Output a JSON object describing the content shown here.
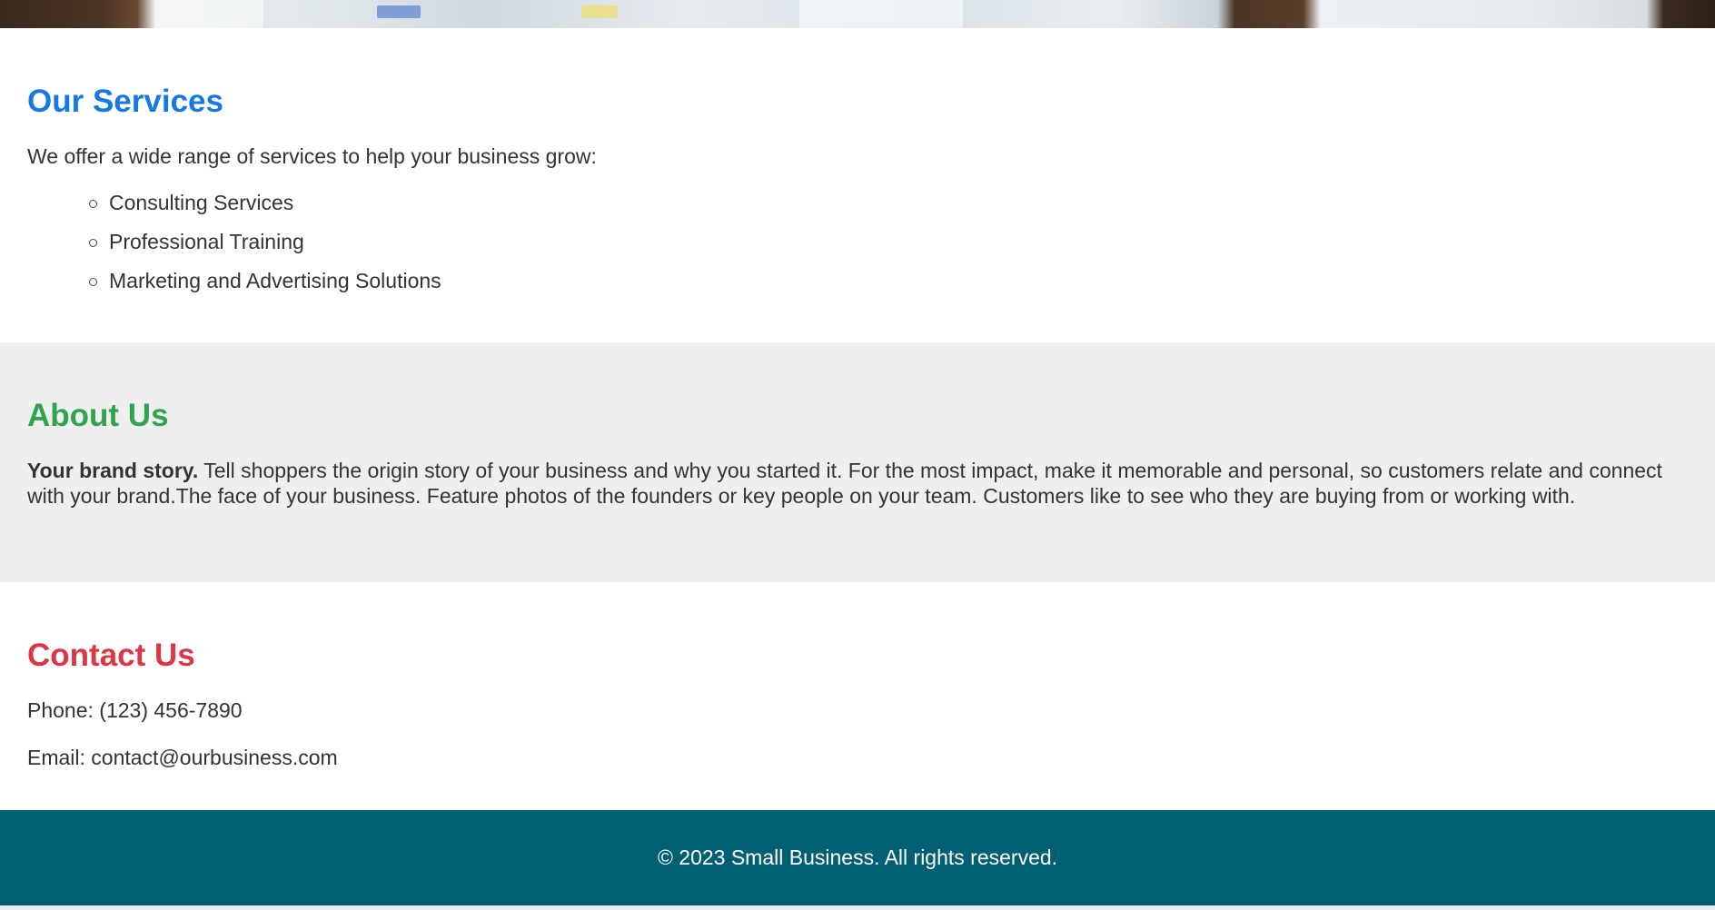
{
  "services": {
    "title": "Our Services",
    "intro": "We offer a wide range of services to help your business grow:",
    "items": [
      "Consulting Services",
      "Professional Training",
      "Marketing and Advertising Solutions"
    ]
  },
  "about": {
    "title": "About Us",
    "lead": "Your brand story.",
    "body": " Tell shoppers the origin story of your business and why you started it. For the most impact, make it memorable and personal, so customers relate and connect with your brand.The face of your business. Feature photos of the founders or key people on your team. Customers like to see who they are buying from or working with."
  },
  "contact": {
    "title": "Contact Us",
    "phone": "Phone: (123) 456-7890",
    "email": "Email: contact@ourbusiness.com"
  },
  "footer": {
    "text": "© 2023 Small Business. All rights reserved."
  },
  "colors": {
    "services_heading": "#1479e3",
    "about_heading": "#2ea44f",
    "contact_heading": "#dc3545",
    "footer_bg": "#005f73",
    "about_bg": "#efefef"
  }
}
